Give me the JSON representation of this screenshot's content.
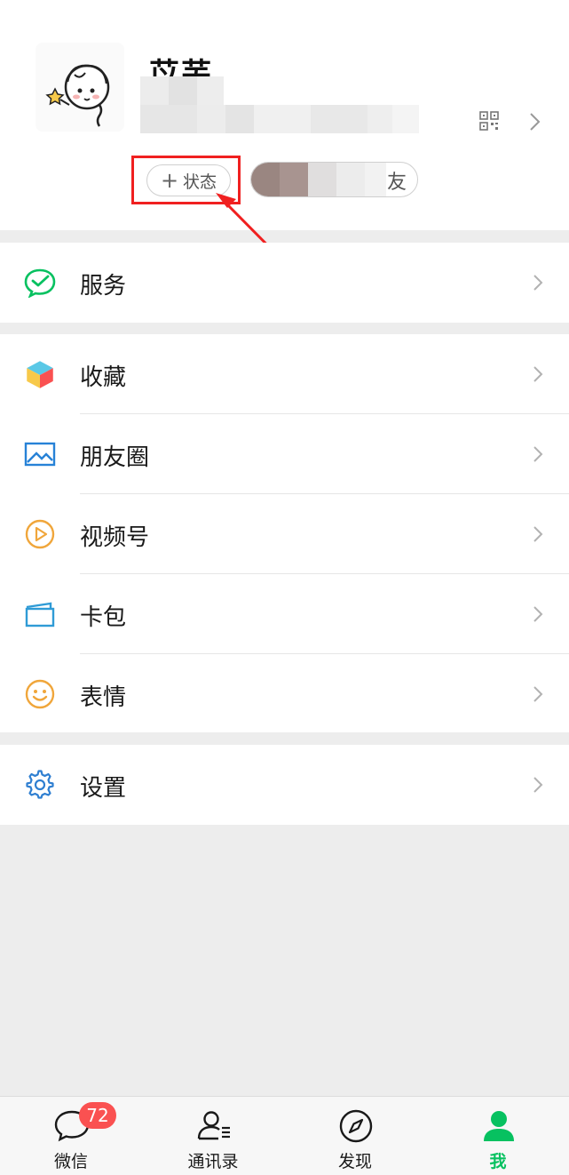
{
  "profile": {
    "nickname": "苡芜",
    "status_button": {
      "plus": "+",
      "label": "状态"
    },
    "friend_pill_tail": "友"
  },
  "menu": {
    "service": {
      "label": "服务",
      "icon": "wechat-pay-icon"
    },
    "group2": [
      {
        "label": "收藏",
        "icon": "favorites-cube-icon"
      },
      {
        "label": "朋友圈",
        "icon": "moments-picture-icon"
      },
      {
        "label": "视频号",
        "icon": "channels-play-icon"
      },
      {
        "label": "卡包",
        "icon": "card-wallet-icon"
      },
      {
        "label": "表情",
        "icon": "sticker-smile-icon"
      }
    ],
    "settings": {
      "label": "设置",
      "icon": "gear-icon"
    }
  },
  "tabbar": {
    "tabs": [
      {
        "label": "微信",
        "icon": "chat-bubble-icon"
      },
      {
        "label": "通讯录",
        "icon": "contacts-icon"
      },
      {
        "label": "发现",
        "icon": "compass-icon"
      },
      {
        "label": "我",
        "icon": "person-icon"
      }
    ],
    "chats_badge": "72",
    "active_tab": "我"
  },
  "colors": {
    "brand_green": "#07c160",
    "badge_red": "#fa5151",
    "annotation_red": "#f02020",
    "page_bg": "#ededed"
  }
}
